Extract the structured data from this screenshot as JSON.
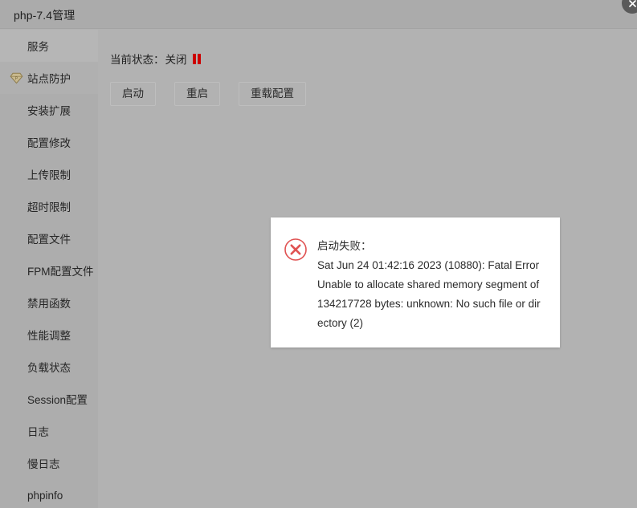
{
  "window": {
    "title": "php-7.4管理",
    "close_icon": "close-icon"
  },
  "sidebar": {
    "items": [
      {
        "label": "服务",
        "icon": null,
        "state": "active"
      },
      {
        "label": "站点防护",
        "icon": "shield-gem-icon",
        "state": "highlight"
      },
      {
        "label": "安装扩展",
        "icon": null,
        "state": "normal"
      },
      {
        "label": "配置修改",
        "icon": null,
        "state": "normal"
      },
      {
        "label": "上传限制",
        "icon": null,
        "state": "normal"
      },
      {
        "label": "超时限制",
        "icon": null,
        "state": "normal"
      },
      {
        "label": "配置文件",
        "icon": null,
        "state": "normal"
      },
      {
        "label": "FPM配置文件",
        "icon": null,
        "state": "normal"
      },
      {
        "label": "禁用函数",
        "icon": null,
        "state": "normal"
      },
      {
        "label": "性能调整",
        "icon": null,
        "state": "normal"
      },
      {
        "label": "负载状态",
        "icon": null,
        "state": "normal"
      },
      {
        "label": "Session配置",
        "icon": null,
        "state": "normal"
      },
      {
        "label": "日志",
        "icon": null,
        "state": "normal"
      },
      {
        "label": "慢日志",
        "icon": null,
        "state": "normal"
      },
      {
        "label": "phpinfo",
        "icon": null,
        "state": "normal"
      }
    ]
  },
  "main": {
    "status_label": "当前状态：",
    "status_value": "关闭",
    "status_icon": "pause-stopped-icon",
    "status_color": "#cc0000",
    "buttons": [
      {
        "label": "启动",
        "name": "start-button"
      },
      {
        "label": "重启",
        "name": "restart-button"
      },
      {
        "label": "重载配置",
        "name": "reload-config-button"
      }
    ]
  },
  "dialog": {
    "icon": "error-circle-x-icon",
    "icon_color": "#e05252",
    "title": "启动失败：",
    "detail": "Sat Jun 24 01:42:16 2023 (10880): Fatal Error Unable to allocate shared memory segment of 134217728 bytes: unknown: No such file or directory (2)"
  },
  "colors": {
    "header_bg": "#ababab",
    "sidebar_bg": "#adadad",
    "content_bg": "#b2b2b2",
    "dialog_bg": "#ffffff",
    "accent_error": "#cc0000"
  }
}
